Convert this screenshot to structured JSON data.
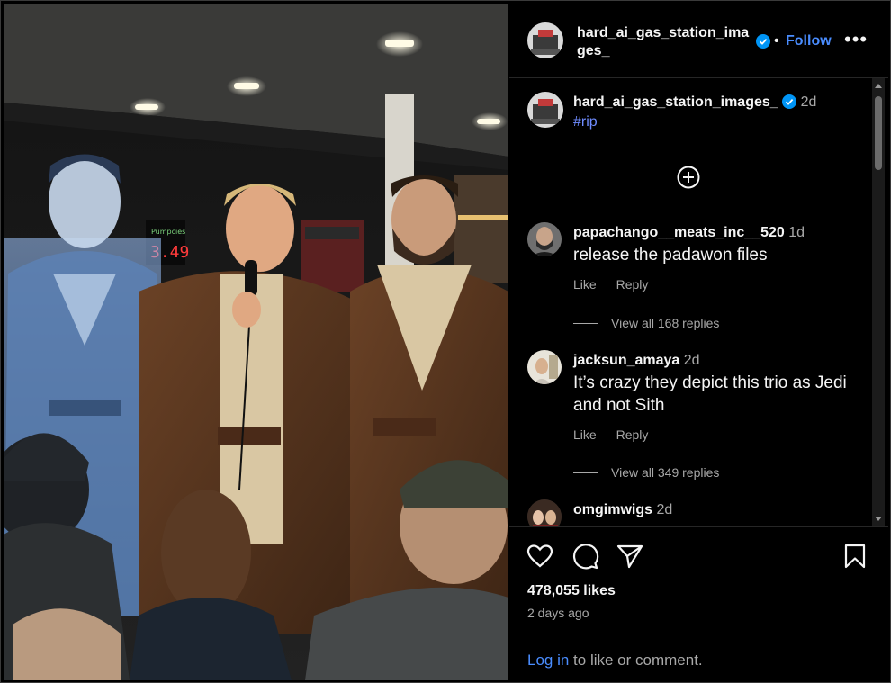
{
  "post": {
    "username": "hard_ai_gas_station_images_",
    "header_name_line1": "hard_ai_gas_station_ima",
    "header_name_line2": "ges_",
    "follow_label": "Follow",
    "dot": "•",
    "more_label": "•••",
    "caption_time": "2d",
    "caption_hashtag": "#rip"
  },
  "photo": {
    "price_label": "Pumpcies",
    "price_value": "3.49"
  },
  "comments": [
    {
      "username": "papachango__meats_inc__520",
      "time": "1d",
      "text": "release the padawon files",
      "like_label": "Like",
      "reply_label": "Reply",
      "view_replies": "View all 168 replies"
    },
    {
      "username": "jacksun_amaya",
      "time": "2d",
      "text": "It’s crazy they depict this trio as Jedi and not Sith",
      "like_label": "Like",
      "reply_label": "Reply",
      "view_replies": "View all 349 replies"
    },
    {
      "username": "omgimwigs",
      "time": "2d",
      "text": ""
    }
  ],
  "footer": {
    "likes": "478,055 likes",
    "posted_ago": "2 days ago",
    "login_link": "Log in",
    "login_rest": " to like or comment."
  },
  "icons": {
    "verified": "verified-badge-icon",
    "add": "add-circle-icon",
    "like": "heart-icon",
    "comment": "comment-icon",
    "share": "paper-plane-icon",
    "save": "bookmark-icon"
  },
  "colors": {
    "accent": "#4a8dff",
    "verified": "#0095f6",
    "hashtag": "#6f8cff",
    "muted": "#a8a8a8",
    "price": "#ff3b3b"
  }
}
